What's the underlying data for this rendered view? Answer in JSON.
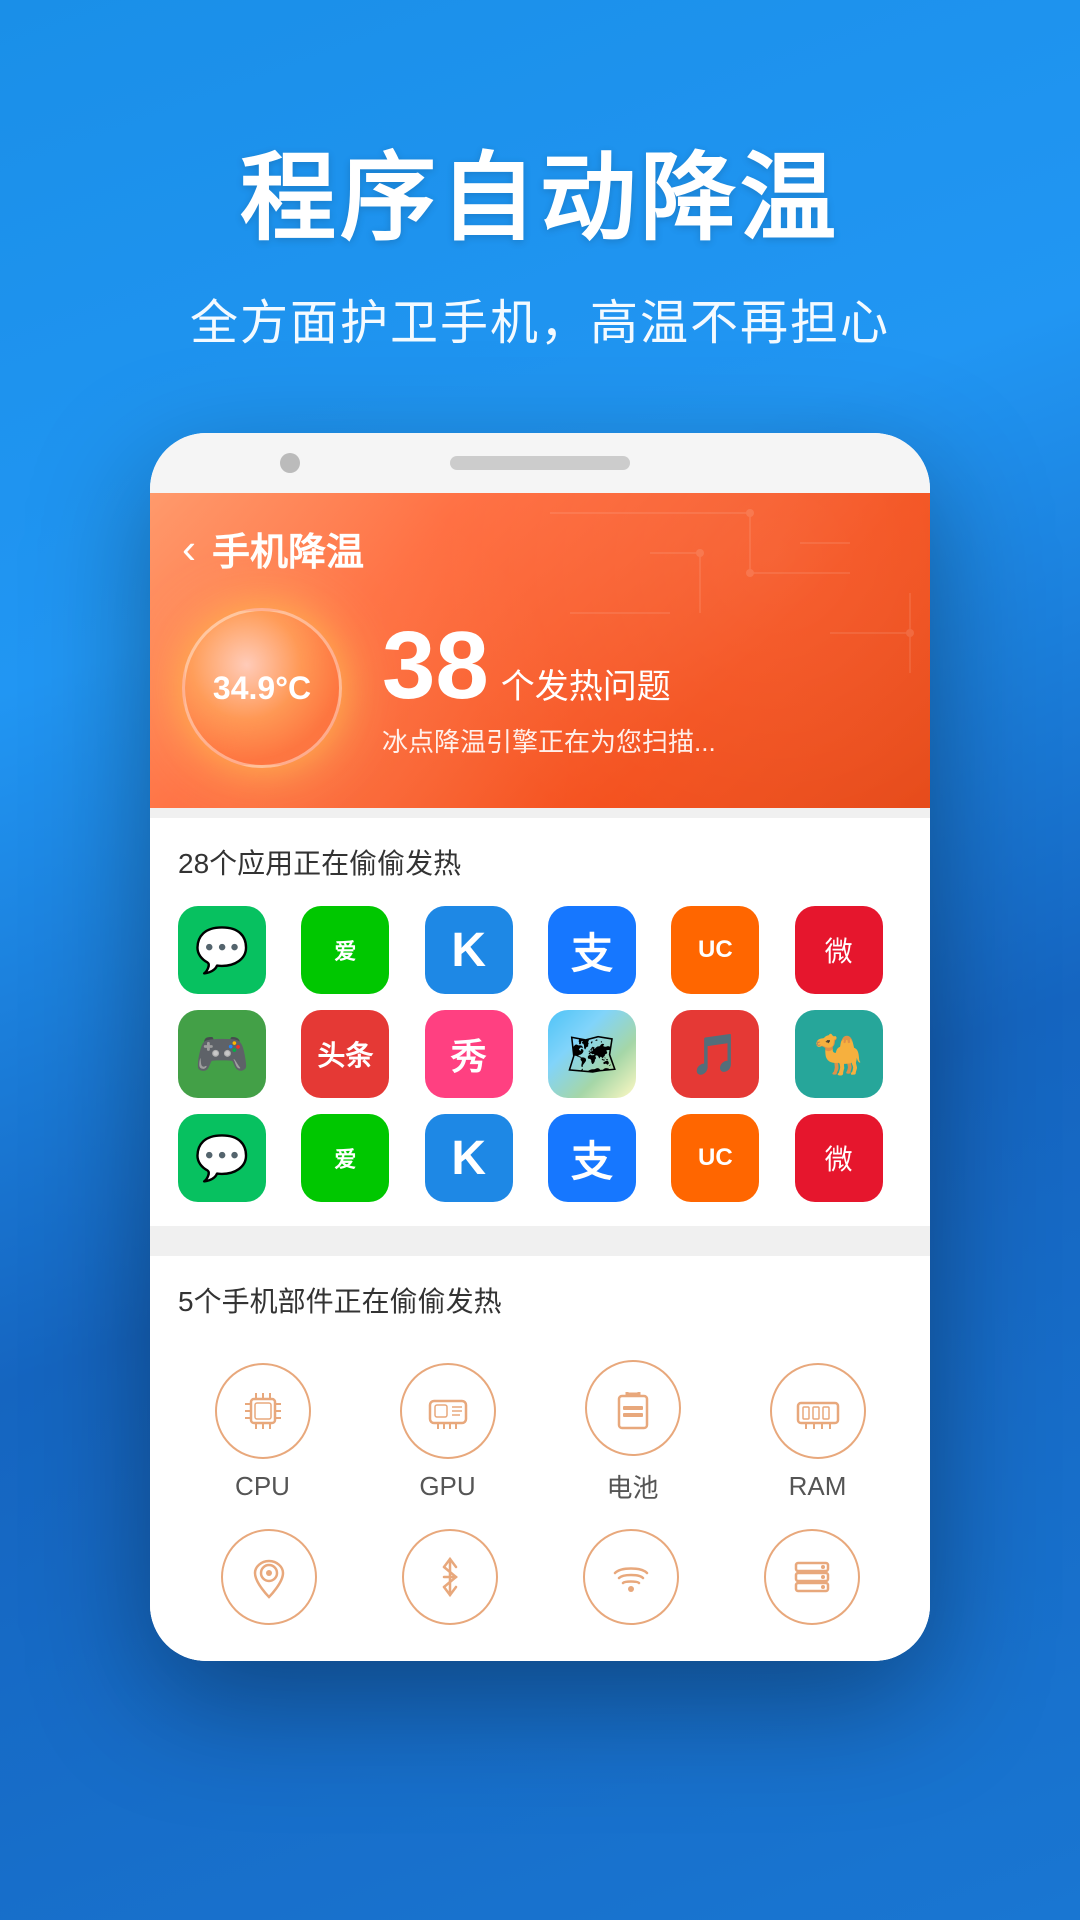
{
  "background": {
    "gradient_start": "#1a8fe8",
    "gradient_end": "#1565C0"
  },
  "hero": {
    "title": "程序自动降温",
    "subtitle": "全方面护卫手机，高温不再担心"
  },
  "app": {
    "nav": {
      "back_label": "‹",
      "title": "手机降温"
    },
    "temperature": {
      "value": "34.9°C",
      "issues_count": "38",
      "issues_label": "个发热问题",
      "scanning_text": "冰点降温引擎正在为您扫描..."
    },
    "apps_section": {
      "label": "28个应用正在偷偷发热",
      "apps": [
        {
          "name": "WeChat",
          "bg": "#07c160",
          "icon": "💬"
        },
        {
          "name": "iQIYI",
          "bg": "#00c700",
          "icon": "爱"
        },
        {
          "name": "KuGou",
          "bg": "#1e88e5",
          "icon": "K"
        },
        {
          "name": "Alipay",
          "bg": "#1677ff",
          "icon": "支"
        },
        {
          "name": "UC Browser",
          "bg": "#ff6600",
          "icon": "UC"
        },
        {
          "name": "Weibo",
          "bg": "#e6162d",
          "icon": "微"
        },
        {
          "name": "Game",
          "bg": "#43a047",
          "icon": "🎮"
        },
        {
          "name": "Toutiao",
          "bg": "#e53935",
          "icon": "头"
        },
        {
          "name": "Xiu",
          "bg": "#ff4081",
          "icon": "秀"
        },
        {
          "name": "Map",
          "bg": "#4caf50",
          "icon": "🗺"
        },
        {
          "name": "NetEase Music",
          "bg": "#e53935",
          "icon": "🎵"
        },
        {
          "name": "Sogou",
          "bg": "#26a69a",
          "icon": "🐪"
        },
        {
          "name": "WeChat2",
          "bg": "#07c160",
          "icon": "💬"
        },
        {
          "name": "iQIYI2",
          "bg": "#00c700",
          "icon": "爱"
        },
        {
          "name": "KuGou2",
          "bg": "#1e88e5",
          "icon": "K"
        },
        {
          "name": "Alipay2",
          "bg": "#1677ff",
          "icon": "支"
        },
        {
          "name": "UC2",
          "bg": "#ff6600",
          "icon": "UC"
        },
        {
          "name": "Weibo2",
          "bg": "#e6162d",
          "icon": "微"
        }
      ]
    },
    "hardware_section": {
      "label": "5个手机部件正在偷偷发热",
      "components": [
        {
          "name": "CPU",
          "icon": "cpu"
        },
        {
          "name": "GPU",
          "icon": "gpu"
        },
        {
          "name": "电池",
          "icon": "battery"
        },
        {
          "name": "RAM",
          "icon": "ram"
        }
      ]
    },
    "bottom_icons": [
      {
        "name": "位置",
        "icon": "location"
      },
      {
        "name": "蓝牙",
        "icon": "bluetooth"
      },
      {
        "name": "WiFi",
        "icon": "wifi"
      },
      {
        "name": "存储",
        "icon": "storage"
      }
    ]
  }
}
